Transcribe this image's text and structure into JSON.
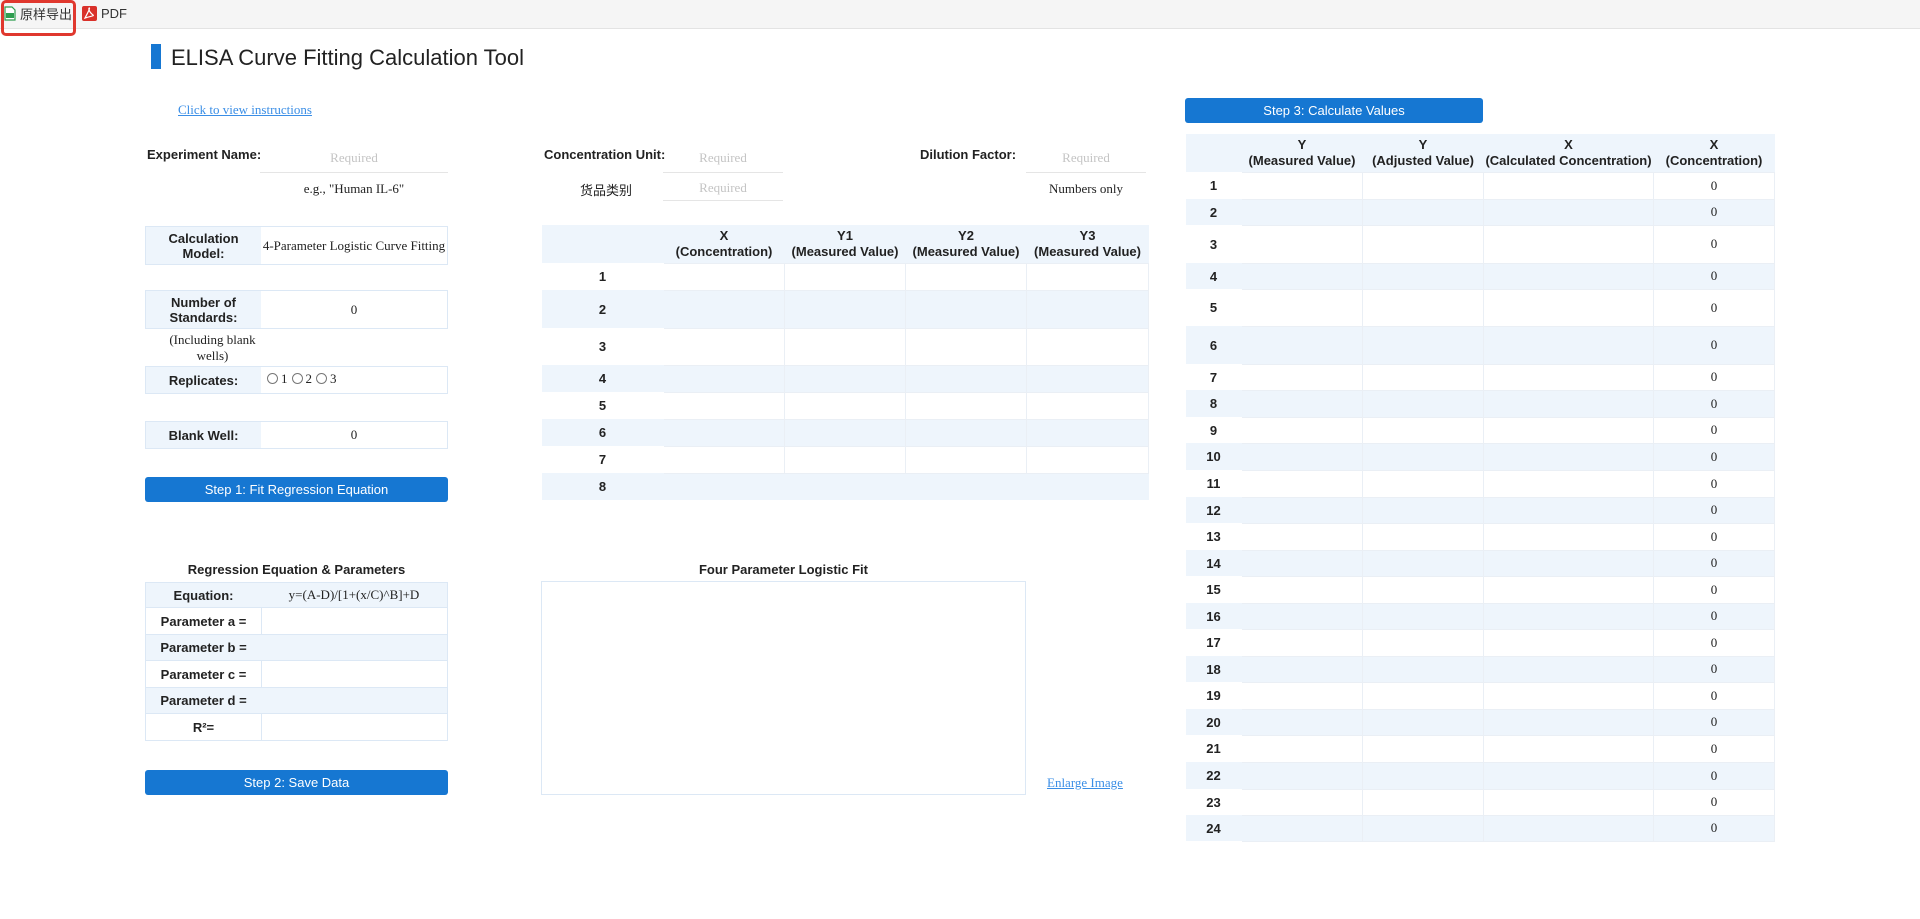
{
  "toolbar": {
    "export_label": "原样导出",
    "pdf_label": "PDF"
  },
  "page": {
    "title": "ELISA Curve Fitting Calculation Tool",
    "instructions_link": "Click to view instructions"
  },
  "experiment": {
    "name_label": "Experiment Name:",
    "name_placeholder": "Required",
    "name_hint": "e.g., \"Human IL-6\"",
    "unit_label": "Concentration Unit:",
    "unit_placeholder": "Required",
    "category_label": "货品类别",
    "category_placeholder": "Required",
    "dilution_label": "Dilution Factor:",
    "dilution_placeholder": "Required",
    "dilution_hint": "Numbers only"
  },
  "settings": {
    "model_label": "Calculation Model:",
    "model_value": "4-Parameter Logistic Curve Fitting",
    "standards_label": "Number of Standards:",
    "standards_value": "0",
    "standards_note": "(Including blank wells)",
    "replicates_label": "Replicates:",
    "replicate_options": [
      "1",
      "2",
      "3"
    ],
    "blank_label": "Blank Well:",
    "blank_value": "0"
  },
  "buttons": {
    "step1": "Step 1: Fit Regression Equation",
    "step2": "Step 2: Save Data",
    "step3": "Step 3: Calculate Values"
  },
  "regression": {
    "heading": "Regression Equation & Parameters",
    "equation_label": "Equation:",
    "equation_value": "y=(A-D)/[1+(x/C)^B]+D",
    "param_a": "Parameter a =",
    "param_b": "Parameter b =",
    "param_c": "Parameter c =",
    "param_d": "Parameter d =",
    "r2": "R²="
  },
  "standards_table": {
    "headers": [
      {
        "l1": "X",
        "l2": "(Concentration)"
      },
      {
        "l1": "Y1",
        "l2": "(Measured Value)"
      },
      {
        "l1": "Y2",
        "l2": "(Measured Value)"
      },
      {
        "l1": "Y3",
        "l2": "(Measured Value)"
      }
    ],
    "rows": [
      "1",
      "2",
      "3",
      "4",
      "5",
      "6",
      "7",
      "8"
    ]
  },
  "plot": {
    "title": "Four Parameter Logistic Fit",
    "enlarge_link": "Enlarge Image"
  },
  "results_table": {
    "headers": [
      {
        "l1": "Y",
        "l2": "(Measured Value)"
      },
      {
        "l1": "Y",
        "l2": "(Adjusted Value)"
      },
      {
        "l1": "X",
        "l2": "(Calculated Concentration)"
      },
      {
        "l1": "X",
        "l2": "(Concentration)"
      }
    ],
    "rows": [
      "1",
      "2",
      "3",
      "4",
      "5",
      "6",
      "7",
      "8",
      "9",
      "10",
      "11",
      "12",
      "13",
      "14",
      "15",
      "16",
      "17",
      "18",
      "19",
      "20",
      "21",
      "22",
      "23",
      "24"
    ],
    "conc_value": "0"
  },
  "colors": {
    "accent": "#1677d2",
    "header_bg": "#eef5fc",
    "highlight_border": "#e0382e"
  }
}
